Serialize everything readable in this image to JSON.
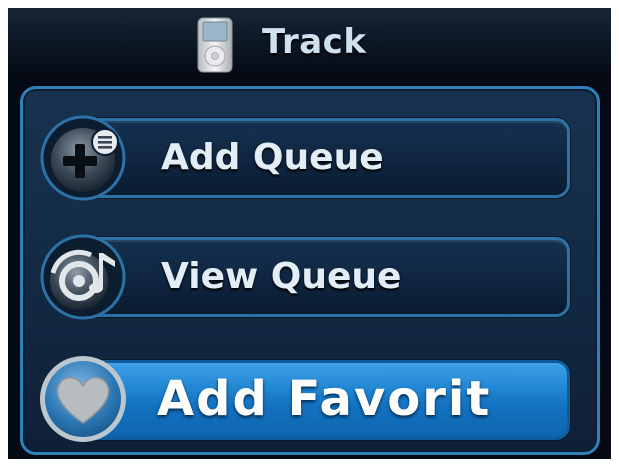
{
  "header": {
    "title": "Track",
    "icon": "ipod-icon"
  },
  "menu": {
    "items": [
      {
        "label": "Add Queue",
        "icon": "add-queue-icon",
        "selected": false
      },
      {
        "label": "View Queue",
        "icon": "view-queue-icon",
        "selected": false
      },
      {
        "label": "Add Favorit",
        "icon": "heart-icon",
        "selected": true
      }
    ]
  },
  "colors": {
    "panel_border": "#2f7fb8",
    "selected_button": "#1d82d0",
    "background": "#050a14"
  }
}
